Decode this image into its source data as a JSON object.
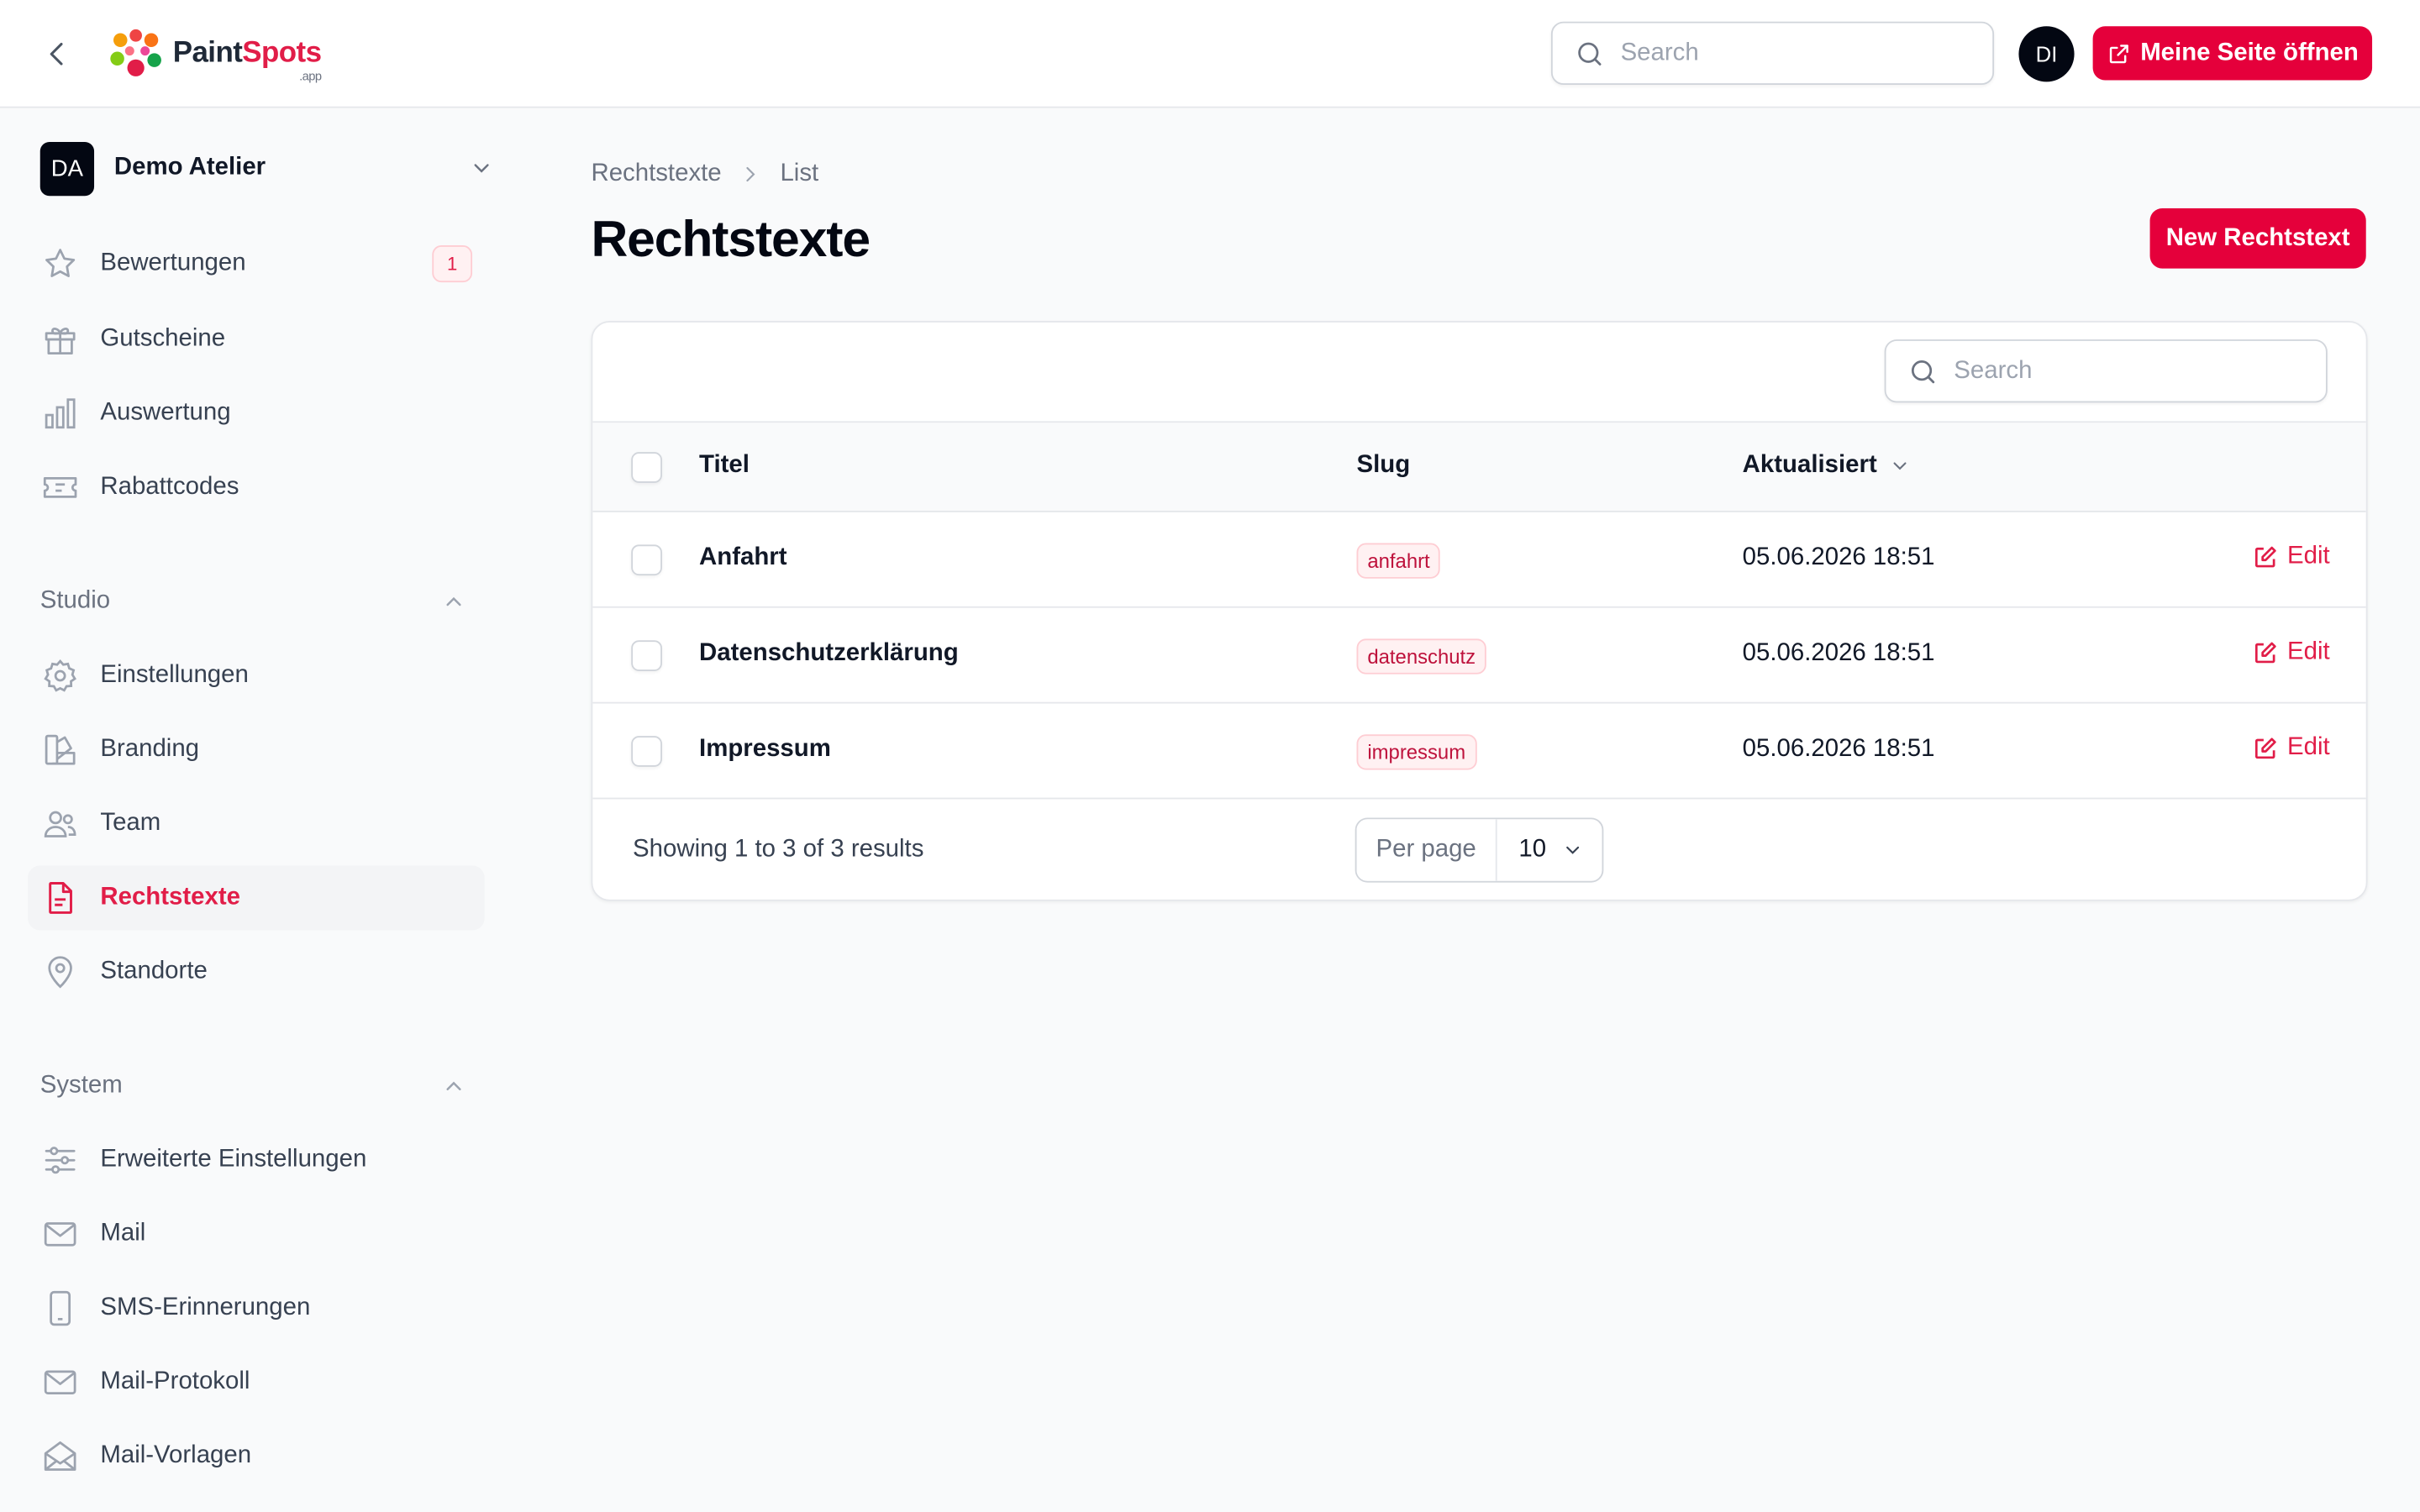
{
  "topbar": {
    "logo_text_a": "Paint",
    "logo_text_b": "Spots",
    "logo_suffix": ".app",
    "search_placeholder": "Search",
    "avatar_initials": "DI",
    "open_site_label": "Meine Seite öffnen"
  },
  "sidebar": {
    "tenant": {
      "initials": "DA",
      "name": "Demo Atelier"
    },
    "top_items": [
      {
        "label": "Bewertungen",
        "icon": "star-icon",
        "badge": "1"
      },
      {
        "label": "Gutscheine",
        "icon": "gift-icon"
      },
      {
        "label": "Auswertung",
        "icon": "chart-bar-icon"
      },
      {
        "label": "Rabattcodes",
        "icon": "ticket-icon"
      }
    ],
    "studio": {
      "label": "Studio",
      "items": [
        {
          "label": "Einstellungen",
          "icon": "cog-icon"
        },
        {
          "label": "Branding",
          "icon": "swatch-icon"
        },
        {
          "label": "Team",
          "icon": "users-icon"
        },
        {
          "label": "Rechtstexte",
          "icon": "document-text-icon",
          "active": true
        },
        {
          "label": "Standorte",
          "icon": "map-pin-icon"
        }
      ]
    },
    "system": {
      "label": "System",
      "items": [
        {
          "label": "Erweiterte Einstellungen",
          "icon": "adjustments-icon"
        },
        {
          "label": "Mail",
          "icon": "envelope-icon"
        },
        {
          "label": "SMS-Erinnerungen",
          "icon": "device-phone-icon"
        },
        {
          "label": "Mail-Protokoll",
          "icon": "envelope-icon"
        },
        {
          "label": "Mail-Vorlagen",
          "icon": "envelope-open-icon"
        }
      ]
    }
  },
  "main": {
    "breadcrumb": [
      "Rechtstexte",
      "List"
    ],
    "title": "Rechtstexte",
    "new_button_label": "New Rechtstext",
    "table": {
      "search_placeholder": "Search",
      "columns": [
        "Titel",
        "Slug",
        "Aktualisiert"
      ],
      "rows": [
        {
          "title": "Anfahrt",
          "slug": "anfahrt",
          "updated": "05.06.2026 18:51",
          "action": "Edit"
        },
        {
          "title": "Datenschutzerklärung",
          "slug": "datenschutz",
          "updated": "05.06.2026 18:51",
          "action": "Edit"
        },
        {
          "title": "Impressum",
          "slug": "impressum",
          "updated": "05.06.2026 18:51",
          "action": "Edit"
        }
      ],
      "results_text": "Showing 1 to 3 of 3 results",
      "per_page_label": "Per page",
      "per_page_value": "10"
    }
  },
  "colors": {
    "accent": "#e5003b",
    "accent_text": "#e11d48"
  }
}
